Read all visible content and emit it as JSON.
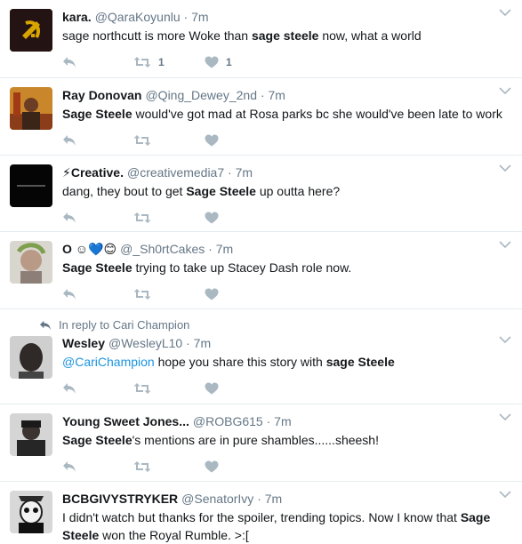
{
  "tweets": [
    {
      "name": "kara.",
      "handle": "@QaraKoyunlu",
      "time": "7m",
      "segments": [
        {
          "t": "sage northcutt is more Woke than "
        },
        {
          "t": "sage steele",
          "b": true
        },
        {
          "t": " now, what a world"
        }
      ],
      "retweets": "1",
      "likes": "1"
    },
    {
      "name": "Ray Donovan",
      "handle": "@Qing_Dewey_2nd",
      "time": "7m",
      "segments": [
        {
          "t": "Sage Steele",
          "b": true
        },
        {
          "t": " would've got mad at Rosa parks bc she would've been late to work"
        }
      ],
      "retweets": "",
      "likes": ""
    },
    {
      "name": "⚡Creative.",
      "handle": "@creativemedia7",
      "time": "7m",
      "segments": [
        {
          "t": "dang, they bout to get "
        },
        {
          "t": "Sage Steele",
          "b": true
        },
        {
          "t": " up outta here?"
        }
      ],
      "retweets": "",
      "likes": ""
    },
    {
      "name": "O ☺💙😊",
      "handle": "@_Sh0rtCakes",
      "time": "7m",
      "segments": [
        {
          "t": "Sage Steele",
          "b": true
        },
        {
          "t": " trying to take up Stacey Dash role now."
        }
      ],
      "retweets": "",
      "likes": ""
    },
    {
      "in_reply_to": "In reply to Cari Champion",
      "name": "Wesley",
      "handle": "@WesleyL10",
      "time": "7m",
      "segments": [
        {
          "t": "@CariChampion",
          "m": true
        },
        {
          "t": " hope you share this story with "
        },
        {
          "t": "sage Steele",
          "b": true
        }
      ],
      "retweets": "",
      "likes": ""
    },
    {
      "name": "Young Sweet Jones...",
      "handle": "@ROBG615",
      "time": "7m",
      "segments": [
        {
          "t": "Sage Steele",
          "b": true
        },
        {
          "t": "'s mentions are in pure shambles......sheesh!"
        }
      ],
      "retweets": "",
      "likes": ""
    },
    {
      "name": "BCBGIVYSTRYKER",
      "handle": "@SenatorIvy",
      "time": "7m",
      "segments": [
        {
          "t": "I didn't watch but thanks for the spoiler, trending topics. Now I know that "
        },
        {
          "t": "Sage Steele",
          "b": true
        },
        {
          "t": " won the Royal Rumble. >:["
        }
      ],
      "retweets": "",
      "likes": ""
    }
  ],
  "icons": {
    "reply": "reply-icon",
    "retweet": "retweet-icon",
    "like": "heart-icon",
    "caret": "chevron-down-icon"
  },
  "colors": {
    "icon": "#aab8c2",
    "muted": "#657786",
    "link": "#1b95e0",
    "divider": "#e6ecf0"
  }
}
